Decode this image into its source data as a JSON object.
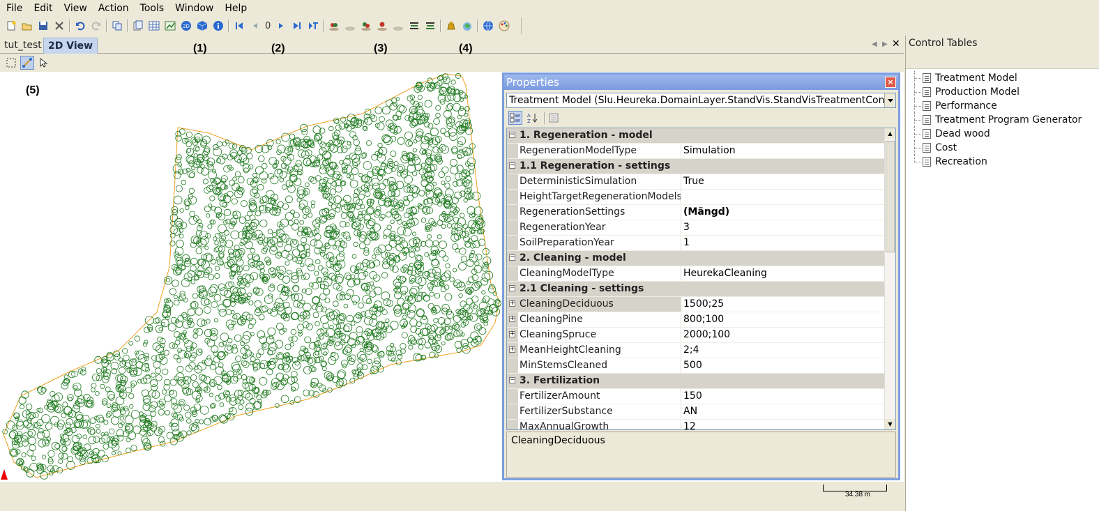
{
  "menu": [
    "File",
    "Edit",
    "View",
    "Action",
    "Tools",
    "Window",
    "Help"
  ],
  "toolbar": {
    "page_number": "0",
    "icons": [
      "new-icon",
      "open-icon",
      "save-icon",
      "delete-icon",
      "undo-icon",
      "redo-icon",
      "copy-icon",
      "report-icon",
      "table-icon",
      "chart-icon",
      "2d-icon",
      "3d-icon",
      "info-icon",
      "first-icon",
      "prev-icon",
      "next-icon",
      "last-icon",
      "goto-icon",
      "tree-icon-1",
      "tree-icon-2",
      "tree-icon-3",
      "tree-icon-4",
      "tree-icon-5",
      "tree-icon-6",
      "tree-icon-7",
      "money-icon",
      "map-icon",
      "globe-icon",
      "palette-icon"
    ]
  },
  "tabs": {
    "inactive": "tut_test",
    "active": "2D View"
  },
  "callouts": {
    "c1": "(1)",
    "c2": "(2)",
    "c3": "(3)",
    "c4": "(4)",
    "c5": "(5)"
  },
  "scale": {
    "label": "34.38 m"
  },
  "properties": {
    "title": "Properties",
    "close": "×",
    "selected_object": "Treatment Model (Slu.Heureka.DomainLayer.StandVis.StandVisTreatmentControlTa",
    "rows": [
      {
        "type": "category",
        "label": "1. Regeneration - model"
      },
      {
        "type": "prop",
        "name": "RegenerationModelType",
        "value": "Simulation"
      },
      {
        "type": "category",
        "label": "1.1 Regeneration - settings"
      },
      {
        "type": "prop",
        "name": "DeterministicSimulation",
        "value": "True"
      },
      {
        "type": "prop",
        "name": "HeightTargetRegenerationModels",
        "value": ""
      },
      {
        "type": "prop",
        "name": "RegenerationSettings",
        "value": "(Mängd)",
        "bold": true
      },
      {
        "type": "prop",
        "name": "RegenerationYear",
        "value": "3"
      },
      {
        "type": "prop",
        "name": "SoilPreparationYear",
        "value": "1"
      },
      {
        "type": "category",
        "label": "2. Cleaning - model"
      },
      {
        "type": "prop",
        "name": "CleaningModelType",
        "value": "HeurekaCleaning"
      },
      {
        "type": "category",
        "label": "2.1 Cleaning - settings"
      },
      {
        "type": "prop",
        "name": "CleaningDeciduous",
        "value": "1500;25",
        "expandable": true,
        "selected": true
      },
      {
        "type": "prop",
        "name": "CleaningPine",
        "value": "800;100",
        "expandable": true
      },
      {
        "type": "prop",
        "name": "CleaningSpruce",
        "value": "2000;100",
        "expandable": true
      },
      {
        "type": "prop",
        "name": "MeanHeightCleaning",
        "value": "2;4",
        "expandable": true
      },
      {
        "type": "prop",
        "name": "MinStemsCleaned",
        "value": "500"
      },
      {
        "type": "category",
        "label": "3. Fertilization"
      },
      {
        "type": "prop",
        "name": "FertilizerAmount",
        "value": "150"
      },
      {
        "type": "prop",
        "name": "FertilizerSubstance",
        "value": "AN"
      },
      {
        "type": "prop",
        "name": "MaxAnnualGrowth",
        "value": "12"
      }
    ],
    "help_text": "CleaningDeciduous"
  },
  "control_tables": {
    "title": "Control Tables",
    "items": [
      "Treatment Model",
      "Production Model",
      "Performance",
      "Treatment Program Generator",
      "Dead wood",
      "Cost",
      "Recreation"
    ]
  },
  "colors": {
    "tree": "#1f7a1f",
    "boundary": "#f0a020",
    "accent": "#7c9ee0"
  }
}
